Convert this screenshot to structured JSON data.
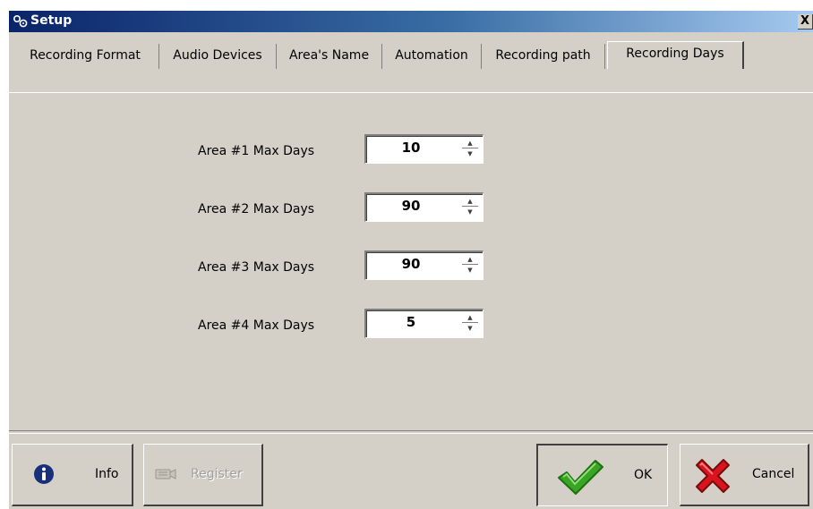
{
  "window": {
    "title": "Setup",
    "close_label": "X"
  },
  "tabs": [
    {
      "label": "Recording Format",
      "active": false
    },
    {
      "label": "Audio Devices",
      "active": false
    },
    {
      "label": "Area's Name",
      "active": false
    },
    {
      "label": "Automation",
      "active": false
    },
    {
      "label": "Recording path",
      "active": false
    },
    {
      "label": "Recording Days",
      "active": true
    }
  ],
  "fields": [
    {
      "label": "Area #1 Max Days",
      "value": "10"
    },
    {
      "label": "Area #2 Max Days",
      "value": "90"
    },
    {
      "label": "Area #3 Max Days",
      "value": "90"
    },
    {
      "label": "Area #4 Max Days",
      "value": "5"
    }
  ],
  "buttons": {
    "info": "Info",
    "register": "Register",
    "ok": "OK",
    "cancel": "Cancel"
  },
  "icons": {
    "title": "gears-icon",
    "info": "info-icon",
    "register": "register-icon",
    "ok": "checkmark-icon",
    "cancel": "cross-icon"
  },
  "colors": {
    "titlebar_start": "#0a246a",
    "titlebar_end": "#a6caf0",
    "face": "#d4d0c8",
    "ok_green": "#3aa524",
    "cancel_red": "#d8141c",
    "info_blue": "#1a2f7a"
  }
}
